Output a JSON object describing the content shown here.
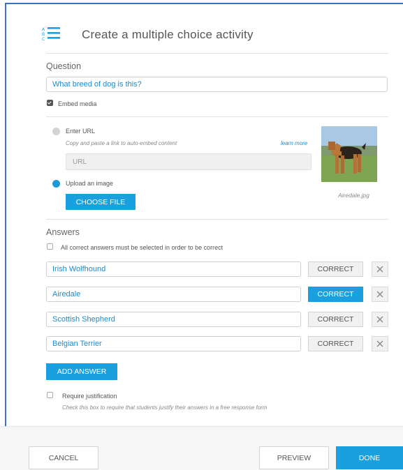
{
  "header": {
    "title": "Create a multiple choice activity",
    "icon": "abc-list-icon"
  },
  "question": {
    "label": "Question",
    "value": "What breed of dog is this?",
    "embed_media_label": "Embed media",
    "embed_media_checked": true
  },
  "media": {
    "enter_url_label": "Enter URL",
    "enter_url_hint": "Copy and paste a link to auto-embed content",
    "learn_more": "learn more",
    "url_placeholder": "URL",
    "upload_label": "Upload an image",
    "choose_file": "CHOOSE FILE",
    "filename": "Airedale.jpg",
    "selected_option": "upload"
  },
  "answers": {
    "label": "Answers",
    "all_correct_label": "All correct answers must be selected in order to be correct",
    "all_correct_checked": false,
    "correct_label": "CORRECT",
    "items": [
      {
        "text": "Irish Wolfhound",
        "correct": false
      },
      {
        "text": "Airedale",
        "correct": true
      },
      {
        "text": "Scottish Shepherd",
        "correct": false
      },
      {
        "text": "Belgian Terrier",
        "correct": false
      }
    ],
    "add_answer": "ADD ANSWER"
  },
  "justification": {
    "label": "Require justification",
    "hint": "Check this box to require that students justify their answers in a free response form",
    "checked": false
  },
  "footer": {
    "cancel": "CANCEL",
    "preview": "PREVIEW",
    "done": "DONE"
  },
  "colors": {
    "accent": "#1aa0de",
    "frame": "#3a6fd0"
  }
}
